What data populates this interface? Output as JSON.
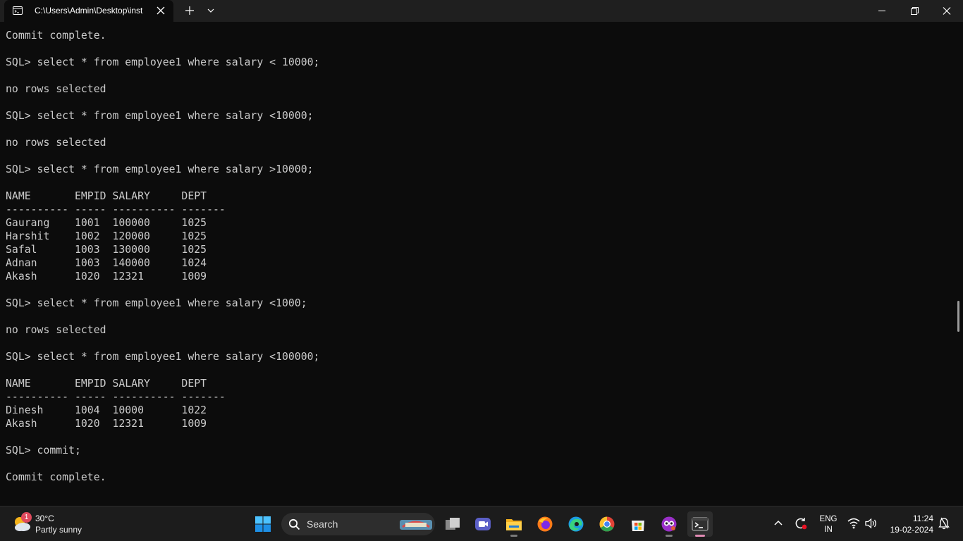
{
  "window": {
    "tab_title": "C:\\Users\\Admin\\Desktop\\inst",
    "tab_icon": "terminal-tab-icon"
  },
  "terminal": {
    "lines": [
      "Commit complete.",
      "",
      "SQL> select * from employee1 where salary < 10000;",
      "",
      "no rows selected",
      "",
      "SQL> select * from employee1 where salary <10000;",
      "",
      "no rows selected",
      "",
      "SQL> select * from employee1 where salary >10000;",
      "",
      "NAME       EMPID SALARY     DEPT",
      "---------- ----- ---------- -------",
      "Gaurang    1001  100000     1025",
      "Harshit    1002  120000     1025",
      "Safal      1003  130000     1025",
      "Adnan      1003  140000     1024",
      "Akash      1020  12321      1009",
      "",
      "SQL> select * from employee1 where salary <1000;",
      "",
      "no rows selected",
      "",
      "SQL> select * from employee1 where salary <100000;",
      "",
      "NAME       EMPID SALARY     DEPT",
      "---------- ----- ---------- -------",
      "Dinesh     1004  10000      1022",
      "Akash      1020  12321      1009",
      "",
      "SQL> commit;",
      "",
      "Commit complete."
    ]
  },
  "taskbar": {
    "weather": {
      "temp": "30°C",
      "desc": "Partly sunny",
      "badge": "1"
    },
    "search_label": "Search",
    "apps": [
      "start",
      "search",
      "task-view",
      "meet",
      "file-explorer",
      "firefox",
      "edge",
      "chrome",
      "microsoft-store",
      "copilot",
      "terminal"
    ],
    "tray": {
      "lang_line1": "ENG",
      "lang_line2": "IN",
      "time": "11:24",
      "date": "19-02-2024"
    }
  },
  "colors": {
    "terminal_bg": "#0c0c0c",
    "terminal_text": "#cccccc",
    "titlebar_bg": "#1f1f1f",
    "taskbar_bg": "#1c1c1c",
    "accent": "#0078d4"
  }
}
